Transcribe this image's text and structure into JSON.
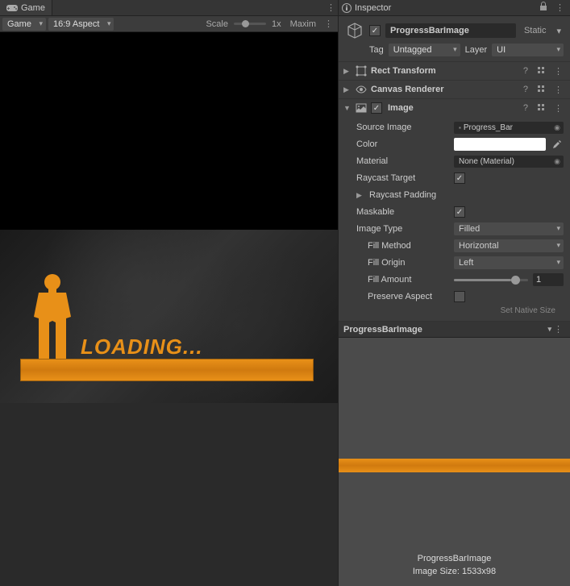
{
  "game_panel": {
    "tab_label": "Game",
    "menu_icon": "⋮",
    "display_dropdown": "Game",
    "aspect_dropdown": "16:9 Aspect",
    "scale_label": "Scale",
    "scale_value": "1x",
    "maximize_label": "Maxim",
    "loading_text": "LOADING...",
    "accent_color": "#e89018"
  },
  "inspector": {
    "tab_label": "Inspector",
    "lock_icon": "🔒",
    "menu_icon": "⋮",
    "object": {
      "enabled": true,
      "name": "ProgressBarImage",
      "static_label": "Static",
      "tag_label": "Tag",
      "tag_value": "Untagged",
      "layer_label": "Layer",
      "layer_value": "UI"
    },
    "components": [
      {
        "title": "Rect Transform",
        "expanded": false,
        "enabled": null,
        "icon": "rect"
      },
      {
        "title": "Canvas Renderer",
        "expanded": false,
        "enabled": null,
        "icon": "eye"
      },
      {
        "title": "Image",
        "expanded": true,
        "enabled": true,
        "icon": "image"
      }
    ],
    "image_component": {
      "source_image_label": "Source Image",
      "source_image_value": "Progress_Bar",
      "color_label": "Color",
      "color_value": "#FFFFFF",
      "material_label": "Material",
      "material_value": "None (Material)",
      "raycast_target_label": "Raycast Target",
      "raycast_target": true,
      "raycast_padding_label": "Raycast Padding",
      "maskable_label": "Maskable",
      "maskable": true,
      "image_type_label": "Image Type",
      "image_type_value": "Filled",
      "fill_method_label": "Fill Method",
      "fill_method_value": "Horizontal",
      "fill_origin_label": "Fill Origin",
      "fill_origin_value": "Left",
      "fill_amount_label": "Fill Amount",
      "fill_amount_value": "1",
      "preserve_aspect_label": "Preserve Aspect",
      "preserve_aspect": false,
      "native_size_hint": "Set Native Size"
    },
    "preview": {
      "title": "ProgressBarImage",
      "caption_name": "ProgressBarImage",
      "caption_size": "Image Size: 1533x98"
    }
  }
}
